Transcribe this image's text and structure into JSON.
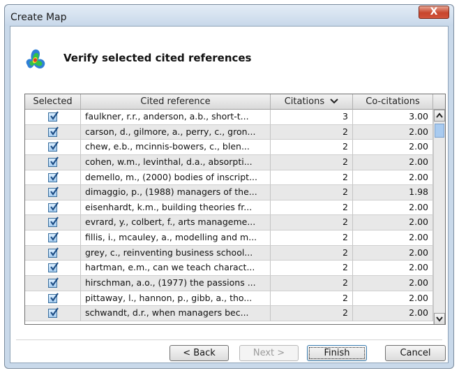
{
  "window": {
    "title": "Create Map",
    "close_label": "X"
  },
  "header": {
    "heading": "Verify selected cited references",
    "icon": "cluster-map-icon"
  },
  "table": {
    "columns": [
      "Selected",
      "Cited reference",
      "Citations",
      "Co-citations"
    ],
    "sort_indicator": "chevron-down-icon",
    "rows": [
      {
        "selected": true,
        "reference": "faulkner, r.r., anderson, a.b., short-t...",
        "citations": "3",
        "cocitations": "3.00"
      },
      {
        "selected": true,
        "reference": "carson, d., gilmore, a., perry, c., gron...",
        "citations": "2",
        "cocitations": "2.00"
      },
      {
        "selected": true,
        "reference": "chew, e.b., mcinnis-bowers, c., blen...",
        "citations": "2",
        "cocitations": "2.00"
      },
      {
        "selected": true,
        "reference": "cohen, w.m., levinthal, d.a., absorpti...",
        "citations": "2",
        "cocitations": "2.00"
      },
      {
        "selected": true,
        "reference": "demello, m., (2000) bodies of inscript...",
        "citations": "2",
        "cocitations": "2.00"
      },
      {
        "selected": true,
        "reference": "dimaggio, p., (1988) managers of the...",
        "citations": "2",
        "cocitations": "1.98"
      },
      {
        "selected": true,
        "reference": "eisenhardt, k.m., building theories fr...",
        "citations": "2",
        "cocitations": "2.00"
      },
      {
        "selected": true,
        "reference": "evrard, y., colbert, f., arts manageme...",
        "citations": "2",
        "cocitations": "2.00"
      },
      {
        "selected": true,
        "reference": "fillis, i., mcauley, a., modelling and m...",
        "citations": "2",
        "cocitations": "2.00"
      },
      {
        "selected": true,
        "reference": "grey, c., reinventing business school...",
        "citations": "2",
        "cocitations": "2.00"
      },
      {
        "selected": true,
        "reference": "hartman, e.m., can we teach charact...",
        "citations": "2",
        "cocitations": "2.00"
      },
      {
        "selected": true,
        "reference": "hirschman, a.o., (1977) the passions ...",
        "citations": "2",
        "cocitations": "2.00"
      },
      {
        "selected": true,
        "reference": "pittaway, l., hannon, p., gibb, a., tho...",
        "citations": "2",
        "cocitations": "2.00"
      },
      {
        "selected": true,
        "reference": "schwandt, d.r., when managers bec...",
        "citations": "2",
        "cocitations": "2.00"
      }
    ]
  },
  "buttons": {
    "back": "< Back",
    "next": "Next >",
    "finish": "Finish",
    "cancel": "Cancel"
  },
  "colors": {
    "checkbox": "#3a6e9c",
    "row_alt": "#e8e8e8",
    "window_frame": "#c9d9ea"
  }
}
